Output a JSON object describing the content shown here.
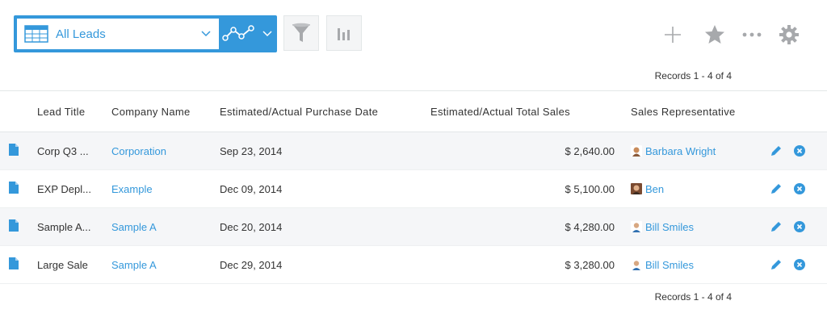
{
  "view": {
    "selected_view": "All Leads"
  },
  "colors": {
    "accent": "#3498db",
    "row_alt": "#f5f6f8",
    "border": "#e3e7e8",
    "icon_grey": "#a7a9ac"
  },
  "records": {
    "top": "Records 1 - 4 of 4",
    "bottom": "Records 1 - 4 of 4"
  },
  "table": {
    "headers": {
      "lead_title": "Lead Title",
      "company_name": "Company Name",
      "purchase_date": "Estimated/Actual Purchase Date",
      "total_sales": "Estimated/Actual Total Sales",
      "sales_rep": "Sales Representative"
    },
    "rows": [
      {
        "title": "Corp Q3 ...",
        "company": "Corporation",
        "date": "Sep 23, 2014",
        "total": "$ 2,640.00",
        "rep": "Barbara Wright"
      },
      {
        "title": "EXP Depl...",
        "company": "Example",
        "date": "Dec 09, 2014",
        "total": "$ 5,100.00",
        "rep": "Ben"
      },
      {
        "title": "Sample A...",
        "company": "Sample A",
        "date": "Dec 20, 2014",
        "total": "$ 4,280.00",
        "rep": "Bill Smiles"
      },
      {
        "title": "Large Sale",
        "company": "Sample A",
        "date": "Dec 29, 2014",
        "total": "$ 3,280.00",
        "rep": "Bill Smiles"
      }
    ]
  }
}
